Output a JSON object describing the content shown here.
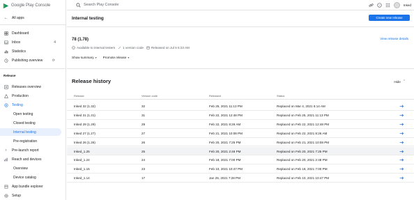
{
  "app": {
    "name": "Google Play Console"
  },
  "sidebar": {
    "all_apps": "All apps",
    "top_items": [
      {
        "label": "Dashboard",
        "icon": "dashboard-icon"
      },
      {
        "label": "Inbox",
        "icon": "inbox-icon",
        "badge": "4"
      },
      {
        "label": "Statistics",
        "icon": "statistics-icon"
      },
      {
        "label": "Publishing overview",
        "icon": "publishing-icon"
      }
    ],
    "section_release": "Release",
    "release_items": [
      {
        "label": "Releases overview"
      },
      {
        "label": "Production"
      },
      {
        "label": "Testing"
      },
      {
        "label": "Open testing"
      },
      {
        "label": "Closed testing"
      },
      {
        "label": "Internal testing"
      },
      {
        "label": "Pre-registration"
      },
      {
        "label": "Pre-launch report"
      },
      {
        "label": "Reach and devices"
      },
      {
        "label": "Overview"
      },
      {
        "label": "Device catalog"
      },
      {
        "label": "App bundle explorer"
      },
      {
        "label": "Setup"
      }
    ]
  },
  "topbar": {
    "search_placeholder": "Search Play Console",
    "account": "Inked"
  },
  "header": {
    "title": "Internal testing",
    "create_button": "Create new release"
  },
  "release": {
    "number": "78 (1.78)",
    "view_details": "View release details",
    "status": "Available to internal testers",
    "version_codes": "1 version code",
    "released_on": "Released on Jul 5 5:23 AM",
    "show_summary": "Show summary",
    "promote": "Promote release"
  },
  "history": {
    "title": "Release history",
    "hide": "Hide",
    "columns": [
      "Release",
      "Version code",
      "Released",
      "Status"
    ],
    "rows": [
      {
        "release": "Inked 32 (1.32)",
        "version": "32",
        "released": "Feb 25, 2021 11:13 PM",
        "status": "Replaced on Mar 4, 2021 6:14 AM"
      },
      {
        "release": "Inked 31 (1.31)",
        "version": "31",
        "released": "Feb 22, 2021 12:48 PM",
        "status": "Replaced on Feb 25, 2021 11:13 PM"
      },
      {
        "release": "Inked 29 (1.29)",
        "version": "29",
        "released": "Feb 22, 2021 8:26 AM",
        "status": "Replaced on Feb 22, 2021 12:48 PM"
      },
      {
        "release": "Inked 27 (1.27)",
        "version": "27",
        "released": "Feb 21, 2021 10:08 PM",
        "status": "Replaced on Feb 22, 2021 8:26 AM"
      },
      {
        "release": "Inked 26 (1.26)",
        "version": "26",
        "released": "Feb 20, 2021 7:25 PM",
        "status": "Replaced on Feb 21, 2021 10:08 PM"
      },
      {
        "release": "Inked_1.25",
        "version": "25",
        "released": "Feb 20, 2021 2:48 PM",
        "status": "Replaced on Feb 20, 2021 7:25 PM"
      },
      {
        "release": "Inked_1.24",
        "version": "24",
        "released": "Feb 18, 2021 7:00 PM",
        "status": "Replaced on Feb 20, 2021 2:48 PM"
      },
      {
        "release": "Inked_1.15",
        "version": "23",
        "released": "Feb 10, 2021 10:47 PM",
        "status": "Replaced on Feb 18, 2021 7:00 PM"
      },
      {
        "release": "Inked_1.14",
        "version": "17",
        "released": "Jan 25, 2021 7:28 PM",
        "status": "Replaced on Feb 10, 2021 10:47 PM"
      }
    ]
  },
  "colors": {
    "accent": "#1a73e8",
    "active_bg": "#e8f0fe",
    "row_highlight": "#f1f3f4"
  }
}
